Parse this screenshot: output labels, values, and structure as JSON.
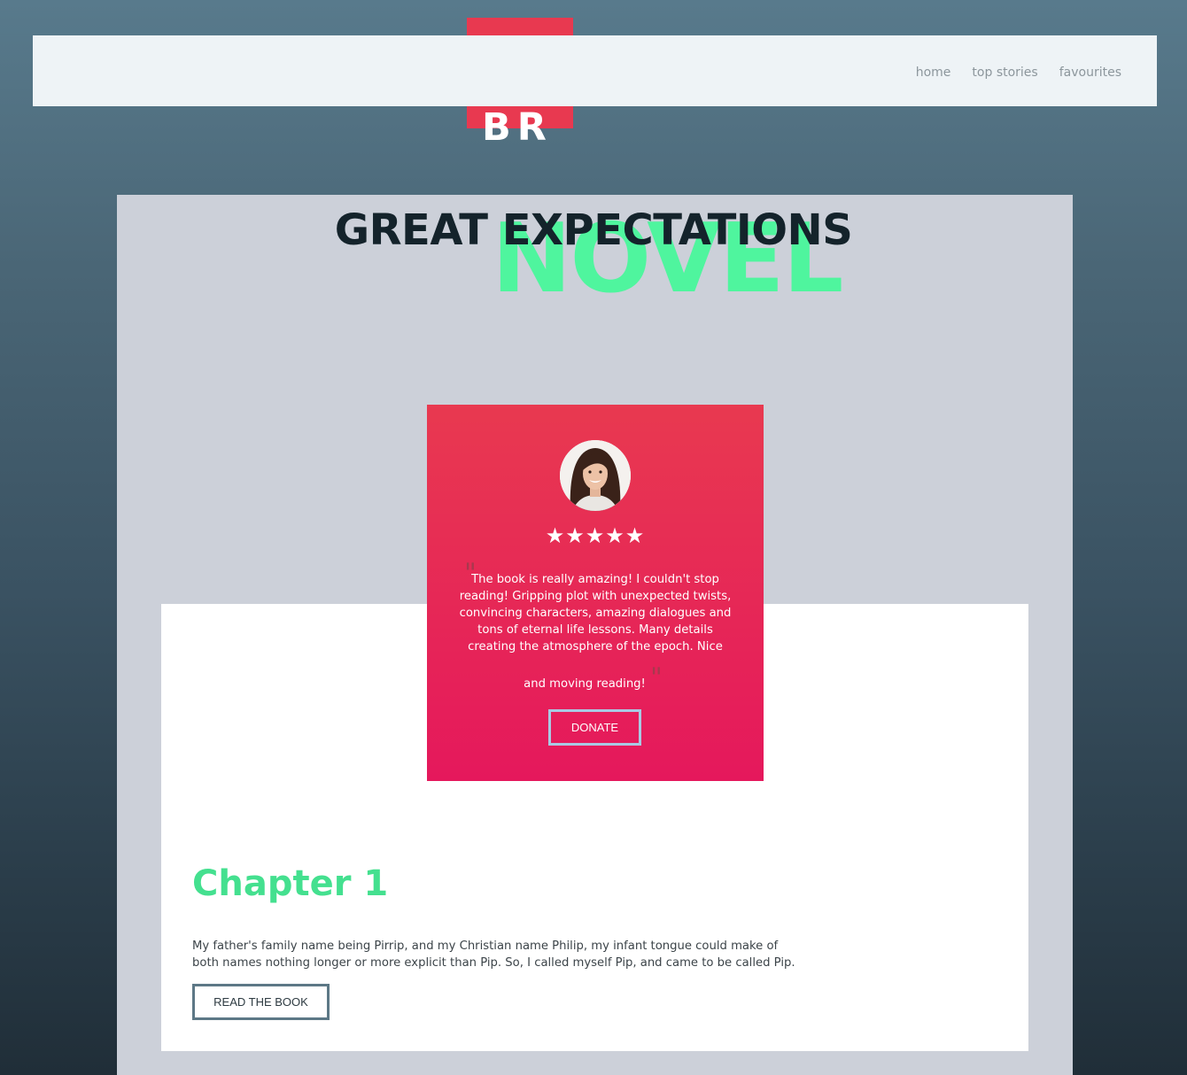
{
  "header": {
    "logo": "BR",
    "nav": [
      {
        "label": "home"
      },
      {
        "label": "top stories"
      },
      {
        "label": "favourites"
      }
    ]
  },
  "hero": {
    "title": "GREAT EXPECTATIONS",
    "subtitle": "NOVEL"
  },
  "testimonial": {
    "rating": 5,
    "stars": "★★★★★",
    "quote_main": "The book is really amazing! I couldn't stop reading! Gripping plot with unexpected twists, convincing characters, amazing dialogues and tons of eternal life lessons. Many details creating the atmosphere of the epoch. Nice",
    "quote_end": "and moving reading!",
    "open_mark": "\"",
    "close_mark": "\"",
    "button_label": "DONATE"
  },
  "chapter": {
    "title": "Chapter 1",
    "text": "My father's family name being Pirrip, and my Christian name Philip, my infant tongue could make of both names nothing longer or more explicit than Pip. So, I called myself Pip, and came to be called Pip.",
    "button_label": "READ THE BOOK"
  },
  "colors": {
    "accent_red": "#e83950",
    "accent_green": "#4ff59e",
    "title_dark": "#14232b",
    "panel": "#ccd0d9"
  }
}
